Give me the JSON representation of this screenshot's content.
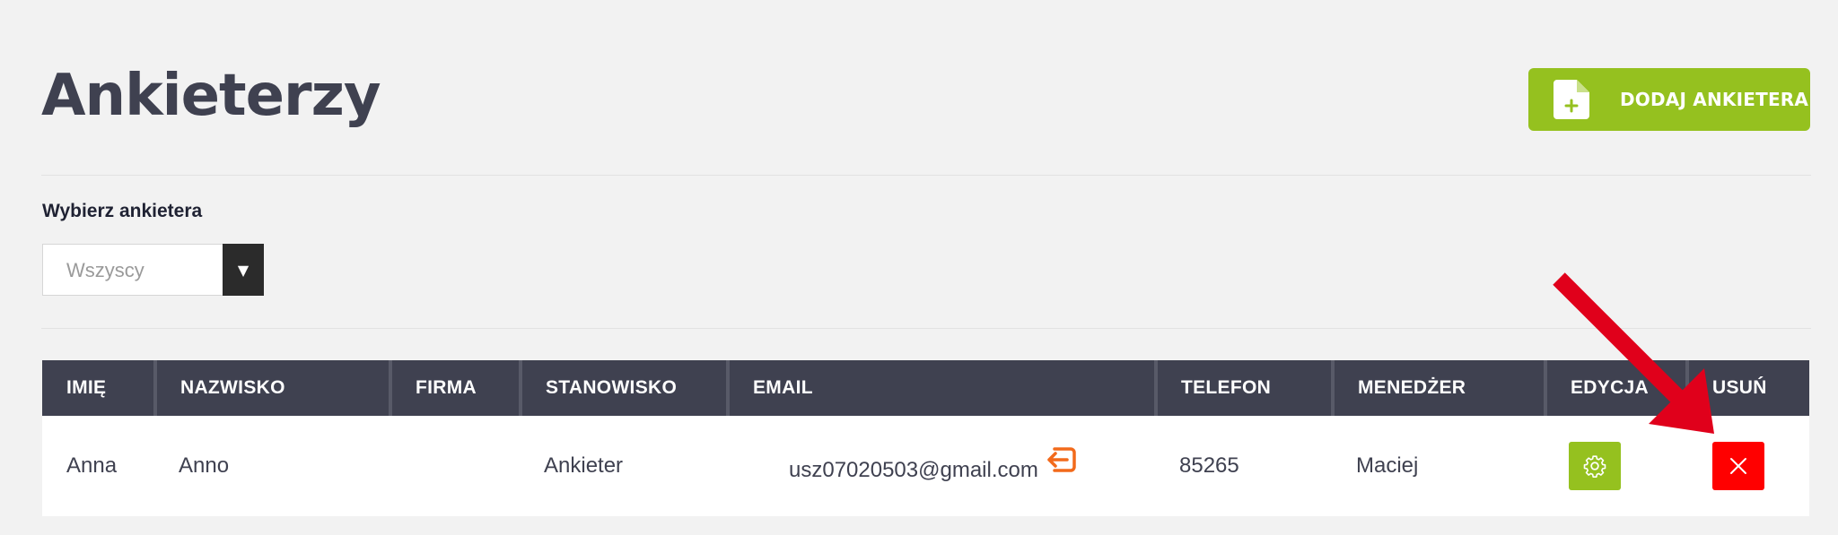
{
  "page": {
    "title": "Ankieterzy"
  },
  "header": {
    "add_button_label": "DODAJ ANKIETERA",
    "add_button_icon": "file-plus-icon"
  },
  "filter": {
    "label": "Wybierz ankietera",
    "selected": "Wszyscy"
  },
  "table": {
    "columns": [
      "IMIĘ",
      "NAZWISKO",
      "FIRMA",
      "STANOWISKO",
      "EMAIL",
      "TELEFON",
      "MENEDŻER",
      "EDYCJA",
      "USUŃ"
    ],
    "rows": [
      {
        "imie": "Anna",
        "nazwisko": "Anno",
        "firma": "",
        "stanowisko": "Ankieter",
        "email": "usz07020503@gmail.com",
        "telefon": "85265",
        "menedzer": "Maciej"
      }
    ]
  },
  "colors": {
    "primary_green": "#95c11f",
    "header_dark": "#3f4150",
    "delete_red": "#ff0000",
    "login_icon_orange": "#f26a1b",
    "annotation_arrow": "#e0001b"
  }
}
